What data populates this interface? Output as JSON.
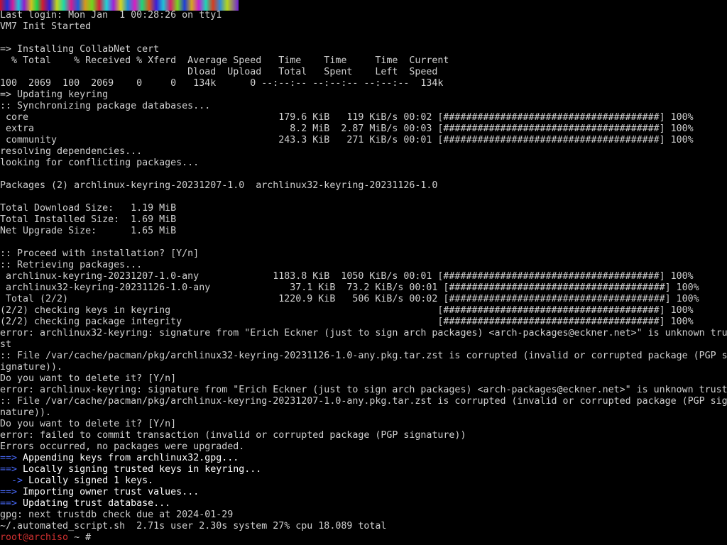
{
  "terminal": {
    "lines": [
      "Last login: Mon Jan  1 00:28:26 on tty1",
      "VM7 Init Started",
      "",
      "=> Installing CollabNet cert",
      "  % Total    % Received % Xferd  Average Speed   Time    Time     Time  Current",
      "                                 Dload  Upload   Total   Spent    Left  Speed",
      "100  2069  100  2069    0     0   134k      0 --:--:-- --:--:-- --:--:--  134k",
      "=> Updating keyring",
      ":: Synchronizing package databases...",
      " core                                            179.6 KiB   119 KiB/s 00:02 [######################################] 100%",
      " extra                                             8.2 MiB  2.87 MiB/s 00:03 [######################################] 100%",
      " community                                       243.3 KiB   271 KiB/s 00:01 [######################################] 100%",
      "resolving dependencies...",
      "looking for conflicting packages...",
      "",
      "Packages (2) archlinux-keyring-20231207-1.0  archlinux32-keyring-20231126-1.0",
      "",
      "Total Download Size:   1.19 MiB",
      "Total Installed Size:  1.69 MiB",
      "Net Upgrade Size:      1.65 MiB",
      "",
      ":: Proceed with installation? [Y/n]",
      ":: Retrieving packages...",
      " archlinux-keyring-20231207-1.0-any             1183.8 KiB  1050 KiB/s 00:01 [######################################] 100%",
      " archlinux32-keyring-20231126-1.0-any              37.1 KiB  73.2 KiB/s 00:01 [######################################] 100%",
      " Total (2/2)                                     1220.9 KiB   506 KiB/s 00:02 [######################################] 100%",
      "(2/2) checking keys in keyring                                               [######################################] 100%",
      "(2/2) checking package integrity                                             [######################################] 100%",
      "error: archlinux32-keyring: signature from \"Erich Eckner (just to sign arch packages) <arch-packages@eckner.net>\" is unknown trust",
      "st",
      ":: File /var/cache/pacman/pkg/archlinux32-keyring-20231126-1.0-any.pkg.tar.zst is corrupted (invalid or corrupted package (PGP s",
      "ignature)).",
      "Do you want to delete it? [Y/n]",
      "error: archlinux-keyring: signature from \"Erich Eckner (just to sign arch packages) <arch-packages@eckner.net>\" is unknown trust",
      ":: File /var/cache/pacman/pkg/archlinux-keyring-20231207-1.0-any.pkg.tar.zst is corrupted (invalid or corrupted package (PGP sig",
      "nature)).",
      "Do you want to delete it? [Y/n]",
      "error: failed to commit transaction (invalid or corrupted package (PGP signature))",
      "Errors occurred, no packages were upgraded."
    ],
    "colored_lines": [
      {
        "arrow": "==>",
        "text": " Appending keys from archlinux32.gpg..."
      },
      {
        "arrow": "==>",
        "text": " Locally signing trusted keys in keyring..."
      },
      {
        "arrow": "  ->",
        "text": " Locally signed 1 keys."
      },
      {
        "arrow": "==>",
        "text": " Importing owner trust values..."
      },
      {
        "arrow": "==>",
        "text": " Updating trust database..."
      }
    ],
    "after_lines": [
      "gpg: next trustdb check due at 2024-01-29",
      "~/.automated_script.sh  2.71s user 2.30s system 27% cpu 18.089 total"
    ],
    "prompt": {
      "user_host": "root@archiso",
      "rest": " ~ #"
    },
    "colors": {
      "background": "#000000",
      "text": "#d0d0d0",
      "arrow": "#4a6cff",
      "prompt_user": "#d03030",
      "highlight": "#ffffff"
    }
  }
}
